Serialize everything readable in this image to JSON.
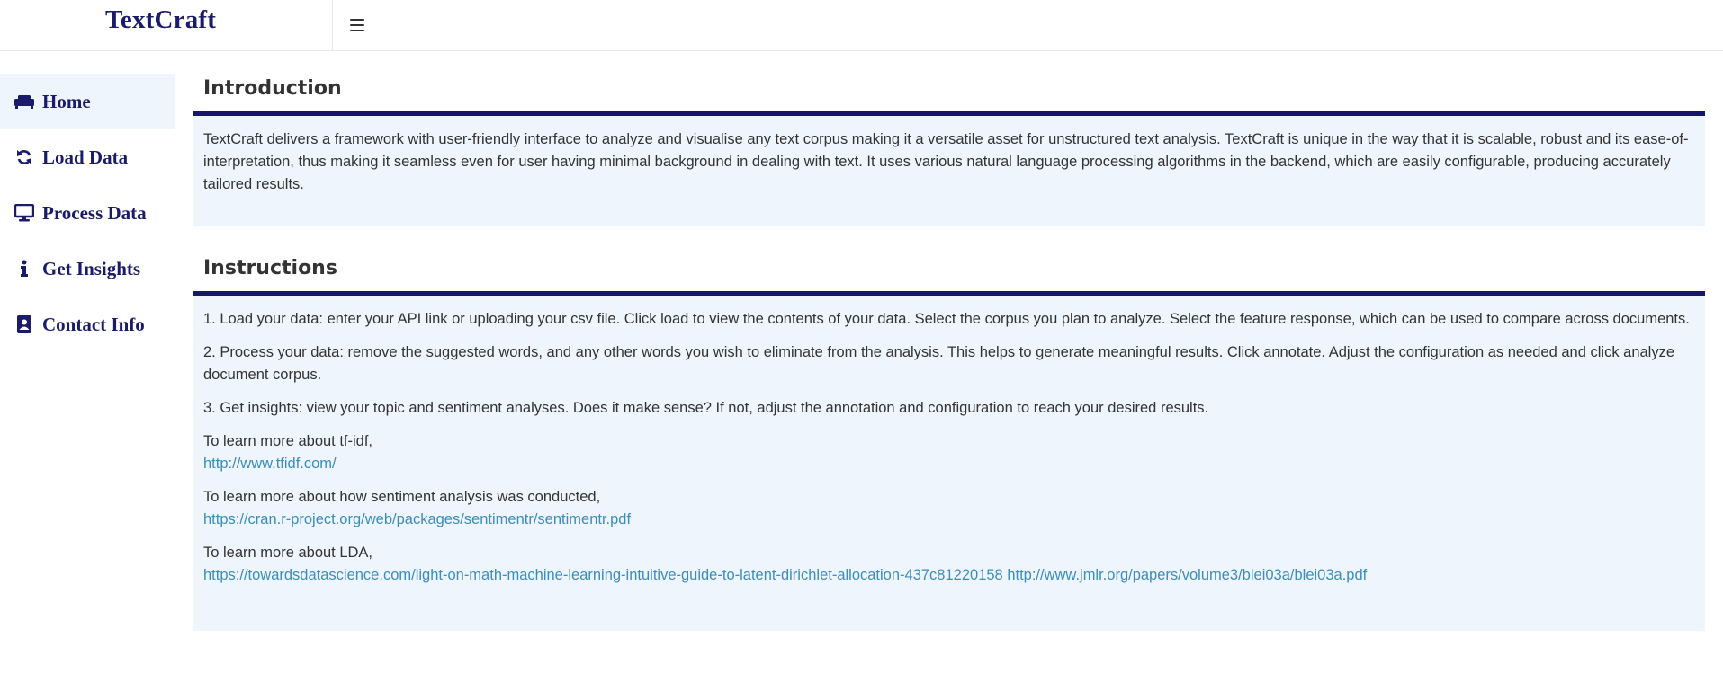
{
  "app": {
    "title": "TextCraft"
  },
  "sidebar": {
    "items": [
      {
        "label": "Home",
        "icon": "couch-icon",
        "active": true
      },
      {
        "label": "Load Data",
        "icon": "refresh-icon",
        "active": false
      },
      {
        "label": "Process Data",
        "icon": "desktop-icon",
        "active": false
      },
      {
        "label": "Get Insights",
        "icon": "info-icon",
        "active": false
      },
      {
        "label": "Contact Info",
        "icon": "address-book-icon",
        "active": false
      }
    ]
  },
  "intro": {
    "title": "Introduction",
    "text": "TextCraft delivers a framework with user-friendly interface to analyze and visualise any text corpus making it a versatile asset for unstructured text analysis. TextCraft is unique in the way that it is scalable, robust and its ease-of-interpretation, thus making it seamless even for user having minimal background in dealing with text. It uses various natural language processing algorithms in the backend, which are easily configurable, producing accurately tailored results."
  },
  "instructions": {
    "title": "Instructions",
    "step1": "1. Load your data: enter your API link or uploading your csv file. Click load to view the contents of your data. Select the corpus you plan to analyze. Select the feature response, which can be used to compare across documents.",
    "step2": "2. Process your data: remove the suggested words, and any other words you wish to eliminate from the analysis. This helps to generate meaningful results. Click annotate. Adjust the configuration as needed and click analyze document corpus.",
    "step3": "3. Get insights: view your topic and sentiment analyses. Does it make sense? If not, adjust the annotation and configuration to reach your desired results.",
    "tfidf_label": "To learn more about tf-idf,",
    "tfidf_link": "http://www.tfidf.com/",
    "sentiment_label": "To learn more about how sentiment analysis was conducted,",
    "sentiment_link": "https://cran.r-project.org/web/packages/sentimentr/sentimentr.pdf",
    "lda_label": "To learn more about LDA,",
    "lda_link1": "https://towardsdatascience.com/light-on-math-machine-learning-intuitive-guide-to-latent-dirichlet-allocation-437c81220158",
    "lda_link2": "http://www.jmlr.org/papers/volume3/blei03a/blei03a.pdf"
  },
  "colors": {
    "brand": "#1b1b6b",
    "panel_bg": "#eef5fd",
    "header_rule": "#16166b",
    "link": "#3c8dbc"
  }
}
